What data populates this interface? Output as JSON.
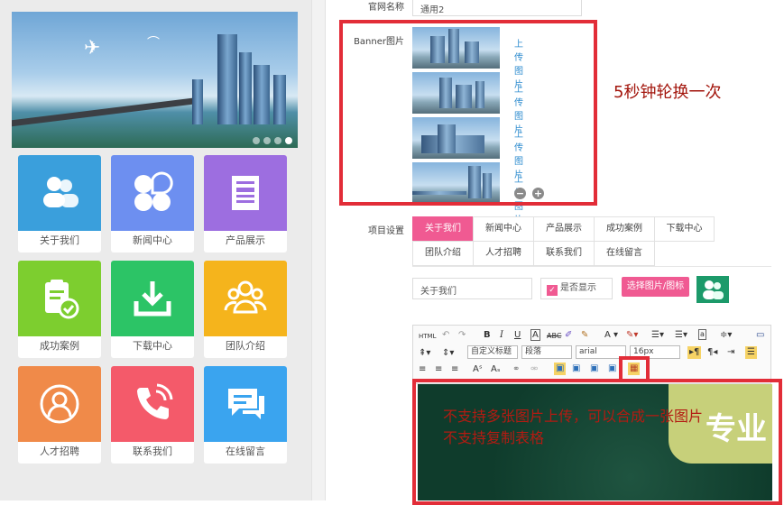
{
  "preview": {
    "tiles": [
      {
        "label": "关于我们",
        "color": "#3a9fdc",
        "icon": "users-icon"
      },
      {
        "label": "新闻中心",
        "color": "#6d8ff0",
        "icon": "grid-icon"
      },
      {
        "label": "产品展示",
        "color": "#9d6ee0",
        "icon": "document-icon"
      },
      {
        "label": "成功案例",
        "color": "#7dce2f",
        "icon": "clipboard-check-icon"
      },
      {
        "label": "下载中心",
        "color": "#2cc466",
        "icon": "download-icon"
      },
      {
        "label": "团队介绍",
        "color": "#f5b41c",
        "icon": "team-icon"
      },
      {
        "label": "人才招聘",
        "color": "#f08a49",
        "icon": "person-icon"
      },
      {
        "label": "联系我们",
        "color": "#f45a6a",
        "icon": "phone-icon"
      },
      {
        "label": "在线留言",
        "color": "#3aa4ef",
        "icon": "chat-icon"
      }
    ]
  },
  "form": {
    "site_name_label": "官网名称",
    "site_name_value": "通用2",
    "banner_label": "Banner图片",
    "upload_label": "上传图片",
    "menu_label": "项目设置",
    "tabs": [
      "关于我们",
      "新闻中心",
      "产品展示",
      "成功案例",
      "下载中心",
      "团队介绍",
      "人才招聘",
      "联系我们",
      "在线留言"
    ],
    "menu_name_value": "关于我们",
    "show_label": "是否显示",
    "pick_button": "选择图片/图标"
  },
  "toolbar": {
    "heading_select": "自定义标题",
    "paragraph_select": "段落",
    "font_select": "arial",
    "size_select": "16px"
  },
  "annotations": {
    "banner_note": "5秒钟轮换一次",
    "editor_note_1": "不支持多张图片上传，可以合成一张图片",
    "editor_note_2": "不支持复制表格"
  },
  "editor": {
    "image_text": "专业"
  },
  "colors": {
    "accent": "#f05a92",
    "annotation_red": "#e22d38",
    "link": "#2e8ccf"
  }
}
